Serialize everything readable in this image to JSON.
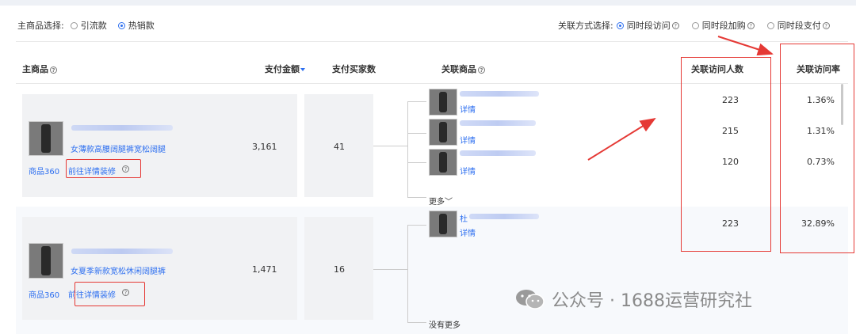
{
  "filters": {
    "main_label": "主商品选择:",
    "main_options": [
      "引流款",
      "热销款"
    ],
    "main_selected": 1,
    "relation_label": "关联方式选择:",
    "relation_options": [
      "同时段访问",
      "同时段加购",
      "同时段支付"
    ],
    "relation_selected": 0
  },
  "columns": {
    "main_product": "主商品",
    "pay_amount": "支付金额",
    "pay_buyers": "支付买家数",
    "related_product": "关联商品",
    "related_visitors": "关联访问人数",
    "related_rate": "关联访问率"
  },
  "rows": [
    {
      "title": "女薄款高腰阔腿裤宽松阔腿",
      "link_360": "商品360",
      "link_detail": "前往详情装修",
      "pay_amount": "3,161",
      "pay_buyers": "41",
      "related": [
        {
          "label": "详情",
          "visitors": "223",
          "rate": "1.36%"
        },
        {
          "label": "详情",
          "visitors": "215",
          "rate": "1.31%"
        },
        {
          "label": "详情",
          "visitors": "120",
          "rate": "0.73%"
        }
      ],
      "more": "更多"
    },
    {
      "title": "女夏季新款宽松休闲阔腿裤",
      "link_360": "商品360",
      "link_detail": "前往详情装修",
      "pay_amount": "1,471",
      "pay_buyers": "16",
      "related": [
        {
          "prefix": "杜",
          "label": "详情",
          "visitors": "223",
          "rate": "32.89%"
        }
      ],
      "more": "没有更多"
    }
  ],
  "watermark": "公众号 · 1688运营研究社",
  "colors": {
    "link": "#2d6ff0",
    "annotation": "#e53935"
  }
}
